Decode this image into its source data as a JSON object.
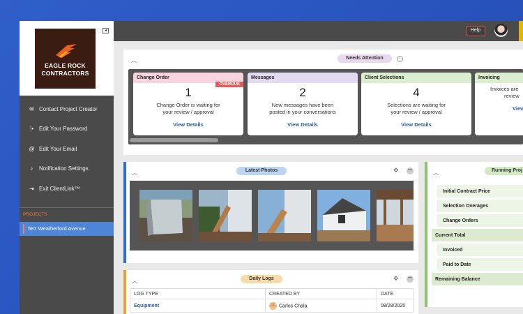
{
  "logo": {
    "line1": "EAGLE ROCK",
    "line2": "CONTRACTORS"
  },
  "sidebar": {
    "items": [
      {
        "label": "Contact Project Creator",
        "icon": "envelope-icon"
      },
      {
        "label": "Edit Your Password",
        "icon": "password-icon"
      },
      {
        "label": "Edit Your Email",
        "icon": "at-icon"
      },
      {
        "label": "Notification Settings",
        "icon": "bell-icon"
      },
      {
        "label": "Exit ClientLink™",
        "icon": "exit-icon"
      }
    ],
    "projects_label": "PROJECTS",
    "project": "587 Weatherford Avenue"
  },
  "topbar": {
    "help_label": "Help"
  },
  "needs_attention": {
    "title": "Needs Attention",
    "cards": [
      {
        "head": "Change Order",
        "count": "1",
        "badge": "OVERDUE",
        "desc1": "Change Order is waiting for",
        "desc2": "your review / approval",
        "link": "View Details",
        "color": "#f9d3dd"
      },
      {
        "head": "Messages",
        "count": "2",
        "desc1": "New messages have been",
        "desc2": "posted in your conversations",
        "link": "View Details",
        "color": "#e3d9f2"
      },
      {
        "head": "Client Selections",
        "count": "4",
        "desc1": "Selections are waiting for",
        "desc2": "your review / approval",
        "link": "View Details",
        "color": "#dbeecf"
      },
      {
        "head": "Invoicing",
        "count": "",
        "desc1": "Invoices are",
        "desc2": "review",
        "link": "View",
        "color": "#dbeecf"
      }
    ]
  },
  "photos": {
    "title": "Latest Photos"
  },
  "logs": {
    "title": "Daily Logs",
    "headers": [
      "LOG TYPE",
      "CREATED BY",
      "DATE"
    ],
    "row": {
      "type": "Equipment",
      "initials": "CC",
      "creator": "Carlos Chala",
      "date": "08/28/2025"
    }
  },
  "running": {
    "title": "Running Proj",
    "rows": [
      "Initial Contract Price",
      "Selection Overages",
      "Change Orders",
      "Current Total",
      "Invoiced",
      "Paid to Date",
      "Remaining Balance"
    ]
  }
}
